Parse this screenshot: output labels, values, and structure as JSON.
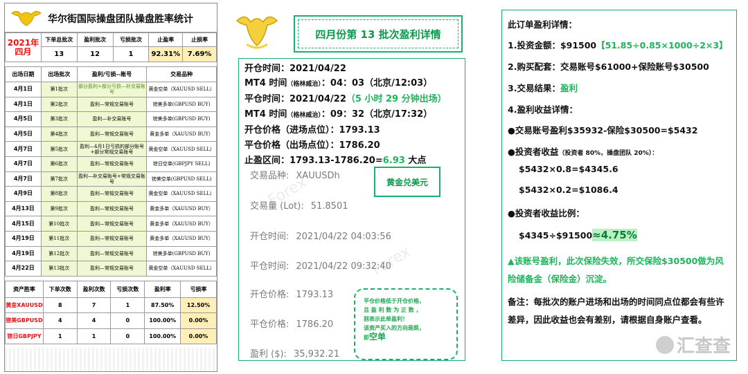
{
  "left": {
    "title": "华尔街国际操盘团队操盘胜率统计",
    "summary_headers": [
      "下单总批次",
      "盈利批次",
      "亏损批次",
      "止盈率",
      "止损率"
    ],
    "period_year": "2021年",
    "period_month": "四月",
    "summary_values": [
      "13",
      "12",
      "1",
      "92.31%",
      "7.69%"
    ],
    "trade_headers": [
      "出场日期",
      "出场批次",
      "盈利/亏损--账号",
      "交易品种"
    ],
    "trades": [
      {
        "date": "4月1日",
        "batch": "第1批次",
        "result": "部分盈利+部分亏损—补交易账号",
        "symbol": "黄金空单（XAUUSD SELL）"
      },
      {
        "date": "4月1日",
        "batch": "第2批次",
        "result": "盈利—常规交易账号",
        "symbol": "镑美多单(GBPUSD BUY)"
      },
      {
        "date": "4月5日",
        "batch": "第3批次",
        "result": "盈利—补交易账号",
        "symbol": "镑美多单(GBPUSD BUY)"
      },
      {
        "date": "4月5日",
        "batch": "第4批次",
        "result": "盈利—常规交易账号",
        "symbol": "黄金多单（XAUUSD BUY）"
      },
      {
        "date": "4月7日",
        "batch": "第5批次",
        "result": "盈利—4月1日亏损的部分账号+部分常规交易账号",
        "symbol": "黄金空单（XAUUSD SELL）"
      },
      {
        "date": "4月7日",
        "batch": "第6批次",
        "result": "盈利—常规交易账号",
        "symbol": "镑日空单(GBPJPY SELL)"
      },
      {
        "date": "4月7日",
        "batch": "第7批次",
        "result": "盈利—补交易账号+常规交易账号",
        "symbol": "镑美空单(GBPUSD SELL)"
      },
      {
        "date": "4月9日",
        "batch": "第8批次",
        "result": "盈利—常规交易账号",
        "symbol": "黄金空单（XAUUSD SELL）"
      },
      {
        "date": "4月13日",
        "batch": "第9批次",
        "result": "盈利—常规交易账号",
        "symbol": "黄金多单（XAUUSD BUY）"
      },
      {
        "date": "4月15日",
        "batch": "第10批次",
        "result": "盈利—常规交易账号",
        "symbol": "黄金多单（XAUUSD BUY）"
      },
      {
        "date": "4月19日",
        "batch": "第11批次",
        "result": "盈利—常规交易账号",
        "symbol": "黄金多单（XAUUSD BUY）"
      },
      {
        "date": "4月19日",
        "batch": "第12批次",
        "result": "盈利—常规交易账号",
        "symbol": "镑美多单(GBPUSD BUY)"
      },
      {
        "date": "4月22日",
        "batch": "第13批次",
        "result": "盈利—常规交易账号",
        "symbol": "黄金空单（XAUUSD SELL）"
      }
    ],
    "asset_headers": [
      "资产胜率",
      "下单次数",
      "盈利次数",
      "亏损次数",
      "盈利率",
      "亏损率"
    ],
    "assets": [
      {
        "name": "黄金XAUUSD",
        "orders": "8",
        "wins": "7",
        "losses": "1",
        "win_rate": "87.50%",
        "loss_rate": "12.50%"
      },
      {
        "name": "镑美GBPUSD",
        "orders": "4",
        "wins": "4",
        "losses": "0",
        "win_rate": "100.00%",
        "loss_rate": "0.00%"
      },
      {
        "name": "镑日GBPJPY",
        "orders": "1",
        "wins": "1",
        "losses": "0",
        "win_rate": "100.00%",
        "loss_rate": "0.00%"
      }
    ]
  },
  "middle": {
    "title": "四月份第 13 批次盈利详情",
    "open_time": "开仓时间：2021/04/22",
    "mt4_open_label": "MT4 时间",
    "mt4_open_tz": "（格林威治）",
    "mt4_open_value": "：04：03（北京/12:03）",
    "close_time": "平仓时间：2021/04/22",
    "close_duration": "（5 小时 29 分钟出场）",
    "mt4_close_label": "MT4 时间",
    "mt4_close_tz": "（格林威治）",
    "mt4_close_value": "：09：32（北京/17:32）",
    "open_price": "开仓价格（进场点位）：1793.13",
    "close_price": "平仓价格（出场点位）：1786.20",
    "range_prefix": "止盈区间：1793.13-1786.20=",
    "range_value": "6.93",
    "range_suffix": " 大点",
    "metal_label": "黄金兑美元",
    "grey_rows": [
      {
        "label": "交易品种:",
        "value": "XAUUSDh"
      },
      {
        "label": "交易量 (Lot):",
        "value": "51.8501"
      },
      {
        "label": "开仓时间:",
        "value": "2021/04/22 04:03:56"
      },
      {
        "label": "平仓时间:",
        "value": "2021/04/22 09:32:40"
      },
      {
        "label": "开仓价格:",
        "value": "1793.13"
      },
      {
        "label": "平仓价格:",
        "value": "1786.20"
      },
      {
        "label": "盈利 ($):",
        "value": "35,932.21"
      }
    ],
    "note_lines": [
      "平仓价格低于开仓价格，",
      "且 盈 利 数 为 正 数 ，",
      "则表示此单盈利！",
      "该资产买入的方向是跌，"
    ],
    "note_last_prefix": "即",
    "note_last_big": "空单"
  },
  "right": {
    "title": "此订单盈利详情：",
    "investment_prefix": "1.投资金额：$91500",
    "investment_calc": "【51.85÷0.85×1000÷2×3】",
    "investment_calc_green": "51.85",
    "allocation": "2.购买配套：交易账号$61000+保险账号$30500",
    "result_prefix": "3.交易结果：",
    "result_value": "盈利",
    "income_title": "4.盈利收益详情：",
    "profit_line": "●交易账号盈利$35932-保险$30500=$5432",
    "investor_income": "●投资者收益",
    "investor_income_note": "（投资者 80%，操盘团队 20%）：",
    "calc1": "$5432×0.8=$4345.6",
    "calc2": "$5432×0.2=$1086.4",
    "ratio_title": "●投资者收益比例：",
    "ratio_prefix": "$4345÷$91500",
    "ratio_value": "≈4.75%",
    "warning": "▲该账号盈利，此次保险失效，所交保险$30500做为风险储备金（保险金）沉淀。",
    "remark": "备注：每批次的账户进场和出场的时间同点位都会有些许差异，因此收益也会有差别，请根据自身账户查看。",
    "brand": "汇查查"
  },
  "colors": {
    "green": "#1db55c",
    "red": "#e11111",
    "highlight": "#fdefb5",
    "rowbg": "#eef8d2"
  }
}
